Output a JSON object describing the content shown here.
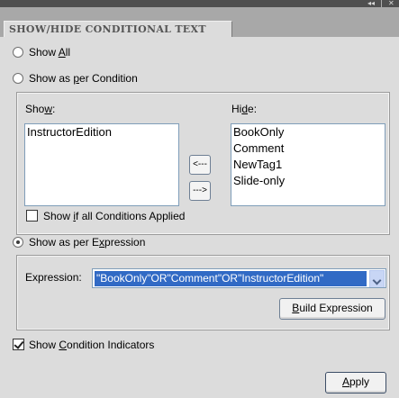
{
  "window": {
    "controls": "◂◂ | ✕",
    "tab_title": "SHOW/HIDE CONDITIONAL TEXT"
  },
  "options": {
    "show_all": {
      "pre": "Show ",
      "key": "A",
      "post": "ll",
      "selected": false
    },
    "show_per_condition": {
      "pre": "Show as ",
      "key": "p",
      "post": "er Condition",
      "selected": false
    },
    "show_per_expression": {
      "pre": "Show as per E",
      "key": "x",
      "post": "pression",
      "selected": true
    }
  },
  "show_list": {
    "label_pre": "Sho",
    "label_key": "w",
    "label_post": ":",
    "items": [
      "InstructorEdition"
    ]
  },
  "hide_list": {
    "label_pre": "Hi",
    "label_key": "d",
    "label_post": "e:",
    "items": [
      "BookOnly",
      "Comment",
      "NewTag1",
      "Slide-only"
    ]
  },
  "move_buttons": {
    "to_show": "<---",
    "to_hide": "--->"
  },
  "all_applied": {
    "pre": "Show ",
    "key": "i",
    "post": "f all Conditions Applied",
    "checked": false
  },
  "expression": {
    "label": "Expression:",
    "value": "\"BookOnly\"OR\"Comment\"OR\"InstructorEdition\""
  },
  "build_expression": {
    "key": "B",
    "post": "uild Expression"
  },
  "indicators": {
    "pre": "Show ",
    "key": "C",
    "post": "ondition Indicators",
    "checked": true
  },
  "apply": {
    "key": "A",
    "post": "pply"
  },
  "colors": {
    "panel": "#dcdcdc",
    "tab_strip": "#a8a8a8",
    "selection": "#316ac5",
    "header_bar": "#4f4f4f"
  }
}
